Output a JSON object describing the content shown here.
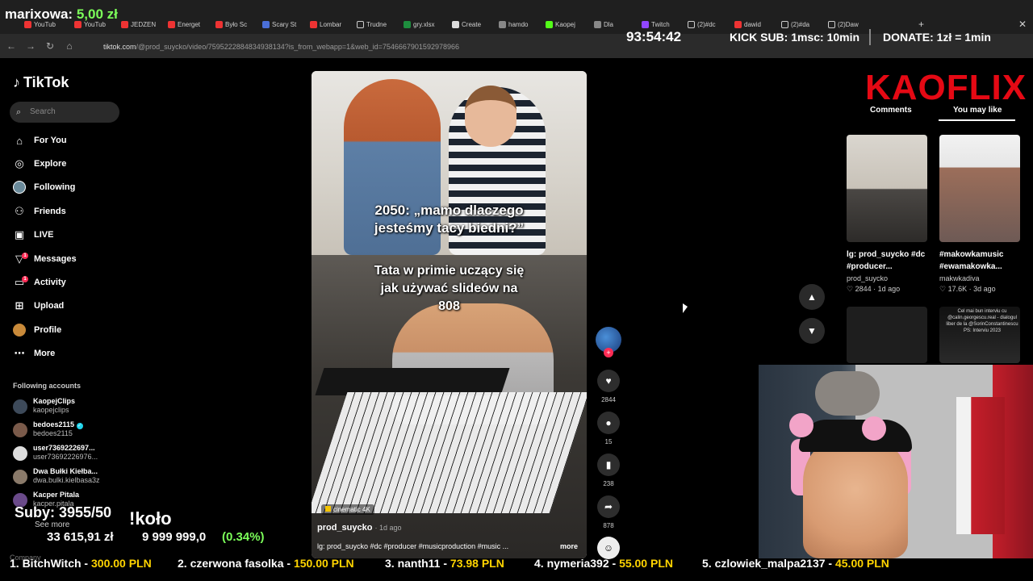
{
  "stream": {
    "donor_name": "marixowa:",
    "donor_amount": "5,00 zł",
    "timer": "93:54:42",
    "kick_sub": "KICK SUB: 1msc: 10min",
    "donate": "DONATE: 1zł = 1min",
    "subs": "Suby: 3955/50",
    "wheel": "!koło",
    "money_a": "33 615,91 zł",
    "money_z": "z",
    "money_b": "9 999 999,0",
    "money_pct": "(0.34%)",
    "ticker": [
      {
        "label": "1. BitchWitch - ",
        "amount": "300.00 PLN"
      },
      {
        "label": "2. czerwona fasolka - ",
        "amount": "150.00 PLN"
      },
      {
        "label": "3. nanth11 - ",
        "amount": "73.98 PLN"
      },
      {
        "label": "4. nymeria392 - ",
        "amount": "55.00 PLN"
      },
      {
        "label": "5. czlowiek_malpa2137 - ",
        "amount": "45.00 PLN"
      }
    ],
    "kaoflix": "KAOFLIX"
  },
  "browser": {
    "tabs": [
      "YouTub",
      "YouTub",
      "JEDZEN",
      "Energet",
      "Było Sc",
      "Scary St",
      "Lombar",
      "Trudne",
      "gry.xlsx",
      "Create",
      "hamdo",
      "Kaopej",
      "Dla",
      "Twitch",
      "(2)#dc",
      "dawid",
      "(2)#da",
      "(2)Daw"
    ],
    "url_host": "tiktok.com",
    "url_path": "/@prod_suycko/video/7595222884834938134?is_from_webapp=1&web_id=7546667901592978966"
  },
  "sidebar": {
    "logo": "TikTok",
    "search_placeholder": "Search",
    "nav": [
      {
        "label": "For You",
        "icon": "home-icon"
      },
      {
        "label": "Explore",
        "icon": "compass-icon"
      },
      {
        "label": "Following",
        "icon": "following-avatar-icon"
      },
      {
        "label": "Friends",
        "icon": "friends-icon"
      },
      {
        "label": "LIVE",
        "icon": "live-icon"
      },
      {
        "label": "Messages",
        "icon": "messages-icon",
        "badge": "1"
      },
      {
        "label": "Activity",
        "icon": "activity-icon",
        "badge": "1"
      },
      {
        "label": "Upload",
        "icon": "upload-icon"
      },
      {
        "label": "Profile",
        "icon": "profile-icon"
      },
      {
        "label": "More",
        "icon": "more-icon"
      }
    ],
    "following_title": "Following accounts",
    "accounts": [
      {
        "name": "KaopejClips",
        "handle": "kaopejclips"
      },
      {
        "name": "bedoes2115",
        "handle": "bedoes2115",
        "verified": true
      },
      {
        "name": "user7369222697...",
        "handle": "user73692226976..."
      },
      {
        "name": "Dwa Bułki Kiełba...",
        "handle": "dwa.bulki.kielbasa3z"
      },
      {
        "name": "Kacper Pitala",
        "handle": "kacper.pitala"
      }
    ],
    "see_more": "See more",
    "company": "Company"
  },
  "video": {
    "caption_top_line1": "2050: „mamo dlaczego",
    "caption_top_line2": "jesteśmy tacy biedni?”",
    "caption_mid_line1": "Tata w primie uczący się",
    "caption_mid_line2": "jak używać slideów na",
    "caption_mid_line3": "808",
    "cinematic": "cinematic 4K",
    "author": "prod_suycko",
    "age": "· 1d ago",
    "desc": "lg: prod_suycko #dc #producer #musicproduction #music ...",
    "more": "more"
  },
  "actions": {
    "likes": "2844",
    "comments": "15",
    "saves": "238",
    "shares": "878"
  },
  "right_panel": {
    "tab_comments": "Comments",
    "tab_you_may_like": "You may like",
    "cards": [
      {
        "title": "lg: prod_suycko #dc #producer...",
        "author": "prod_suycko",
        "likes": "2844",
        "age": "· 1d ago"
      },
      {
        "title": "#makowkamusic #ewamakowka...",
        "author": "makwkadiva",
        "likes": "17.6K",
        "age": "· 3d ago"
      }
    ],
    "card4_text": "Cel mai bun interviu cu @calin.georgescu.real - dialogul liber de la @SorinConstantinescu PS: Interviu 2023"
  },
  "colors": {
    "accent_green": "#7cff5a",
    "ticker_amount": "#ffd400",
    "tiktok_red": "#fe2c55",
    "kaoflix_red": "#e50914"
  }
}
